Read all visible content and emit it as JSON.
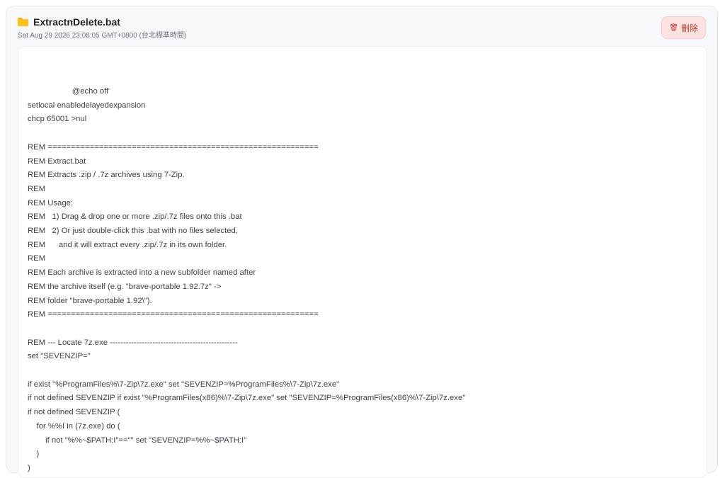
{
  "file": {
    "icon": "folder-icon",
    "title": "ExtractnDelete.bat",
    "timestamp": "Sat Aug 29 2026 23:08:05 GMT+0800 (台北標準時間)"
  },
  "actions": {
    "delete_icon": "trash-icon",
    "delete_label": "刪除"
  },
  "colors": {
    "accent_folder": "#ffc21a",
    "delete_bg": "#fde2e2",
    "delete_text": "#c0392b"
  },
  "script_text": "                    @echo off\nsetlocal enabledelayedexpansion\nchcp 65001 >nul\n\nREM ==========================================================\nREM Extract.bat\nREM Extracts .zip / .7z archives using 7-Zip.\nREM\nREM Usage:\nREM   1) Drag & drop one or more .zip/.7z files onto this .bat\nREM   2) Or just double-click this .bat with no files selected,\nREM      and it will extract every .zip/.7z in its own folder.\nREM\nREM Each archive is extracted into a new subfolder named after\nREM the archive itself (e.g. \"brave-portable 1.92.7z\" ->\nREM folder \"brave-portable 1.92\\\").\nREM ==========================================================\n\nREM --- Locate 7z.exe ------------------------------------------------\nset \"SEVENZIP=\"\n\nif exist \"%ProgramFiles%\\7-Zip\\7z.exe\" set \"SEVENZIP=%ProgramFiles%\\7-Zip\\7z.exe\"\nif not defined SEVENZIP if exist \"%ProgramFiles(x86)%\\7-Zip\\7z.exe\" set \"SEVENZIP=%ProgramFiles(x86)%\\7-Zip\\7z.exe\"\nif not defined SEVENZIP (\n    for %%I in (7z.exe) do (\n        if not \"%%~$PATH:I\"==\"\" set \"SEVENZIP=%%~$PATH:I\"\n    )\n)"
}
